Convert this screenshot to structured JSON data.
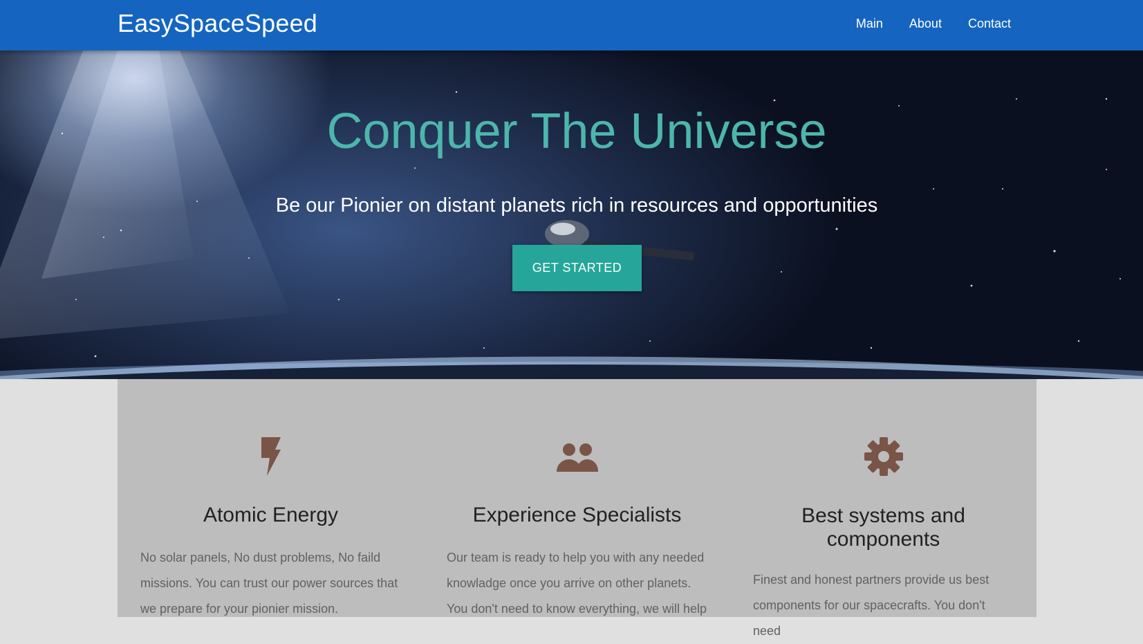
{
  "nav": {
    "brand": "EasySpaceSpeed",
    "links": [
      "Main",
      "About",
      "Contact"
    ]
  },
  "hero": {
    "title": "Conquer The Universe",
    "subtitle": "Be our Pionier on distant planets rich in resources and opportunities",
    "cta_label": "GET STARTED"
  },
  "features": [
    {
      "icon": "flash-icon",
      "title": "Atomic Energy",
      "text": "No solar panels, No dust problems, No faild missions. You can trust our power sources that we prepare for your pionier mission."
    },
    {
      "icon": "group-icon",
      "title": "Experience Specialists",
      "text": "Our team is ready to help you with any needed knowladge once you arrive on other planets. You don't need to know everything, we will help"
    },
    {
      "icon": "gear-icon",
      "title": "Best systems and components",
      "text": "Finest and honest partners provide us best components for our spacecrafts. You don't need"
    }
  ],
  "colors": {
    "navbar": "#1565c0",
    "accent_teal": "#26a69a",
    "title_teal": "#4db6ac",
    "icon_brown": "#795548",
    "features_bg": "#bdbdbd",
    "page_bg": "#e0e0e0"
  }
}
